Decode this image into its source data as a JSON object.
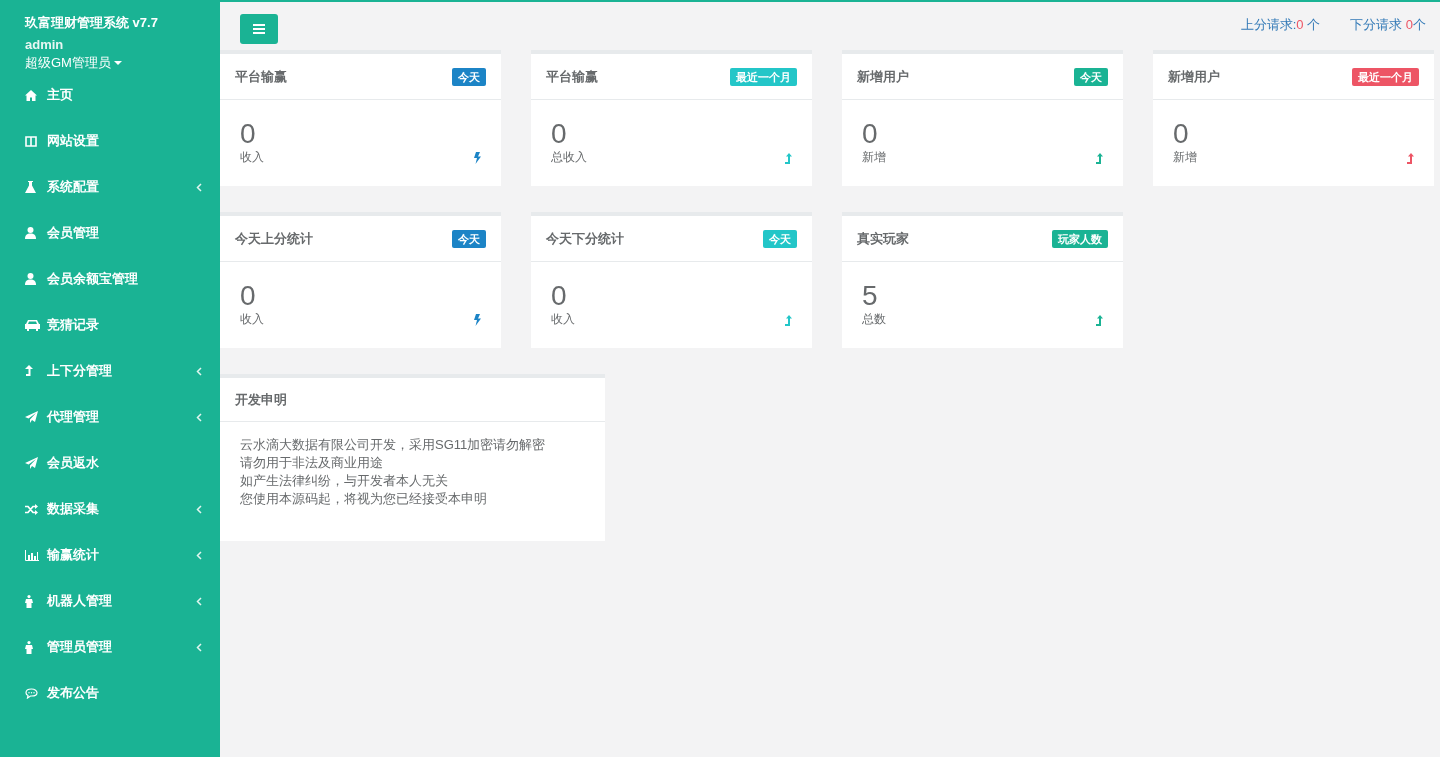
{
  "sidebar": {
    "title": "玖富理财管理系统 v7.7",
    "user": "admin",
    "role": "超级GM管理员",
    "items": [
      {
        "label": "主页",
        "kind": "home",
        "has_submenu": false
      },
      {
        "label": "网站设置",
        "kind": "columns",
        "has_submenu": false
      },
      {
        "label": "系统配置",
        "kind": "flask",
        "has_submenu": true
      },
      {
        "label": "会员管理",
        "kind": "user",
        "has_submenu": false
      },
      {
        "label": "会员余额宝管理",
        "kind": "user",
        "has_submenu": false
      },
      {
        "label": "竞猜记录",
        "kind": "car",
        "has_submenu": false
      },
      {
        "label": "上下分管理",
        "kind": "level-up",
        "has_submenu": true
      },
      {
        "label": "代理管理",
        "kind": "send",
        "has_submenu": true
      },
      {
        "label": "会员返水",
        "kind": "send",
        "has_submenu": false
      },
      {
        "label": "数据采集",
        "kind": "shuffle",
        "has_submenu": true
      },
      {
        "label": "输赢统计",
        "kind": "chart",
        "has_submenu": true
      },
      {
        "label": "机器人管理",
        "kind": "person",
        "has_submenu": true
      },
      {
        "label": "管理员管理",
        "kind": "person",
        "has_submenu": true
      },
      {
        "label": "发布公告",
        "kind": "comment",
        "has_submenu": false
      }
    ]
  },
  "header": {
    "requests": [
      {
        "label": "上分请求:",
        "count": "0",
        "unit": " 个"
      },
      {
        "label": "下分请求 ",
        "count": "0",
        "unit": "个"
      }
    ]
  },
  "stat_rows": [
    [
      {
        "title": "平台输赢",
        "badge": "今天",
        "color": "#1c84c6",
        "value": "0",
        "caption": "收入",
        "kind": "bolt"
      },
      {
        "title": "平台输赢",
        "badge": "最近一个月",
        "color": "#23c6c8",
        "value": "0",
        "caption": "总收入",
        "kind": "arrow"
      },
      {
        "title": "新增用户",
        "badge": "今天",
        "color": "#1ab394",
        "value": "0",
        "caption": "新增",
        "kind": "arrow"
      },
      {
        "title": "新增用户",
        "badge": "最近一个月",
        "color": "#ed5565",
        "value": "0",
        "caption": "新增",
        "kind": "arrow"
      }
    ],
    [
      {
        "title": "今天上分统计",
        "badge": "今天",
        "color": "#1c84c6",
        "value": "0",
        "caption": "收入",
        "kind": "bolt"
      },
      {
        "title": "今天下分统计",
        "badge": "今天",
        "color": "#23c6c8",
        "value": "0",
        "caption": "收入",
        "kind": "arrow"
      },
      {
        "title": "真实玩家",
        "badge": "玩家人数",
        "color": "#1ab394",
        "value": "5",
        "caption": "总数",
        "kind": "arrow"
      }
    ]
  ],
  "notice": {
    "title": "开发申明",
    "lines": [
      "云水滴大数据有限公司开发，采用SG11加密请勿解密",
      "请勿用于非法及商业用途",
      "如产生法律纠纷，与开发者本人无关",
      "您使用本源码起，将视为您已经接受本申明"
    ]
  }
}
